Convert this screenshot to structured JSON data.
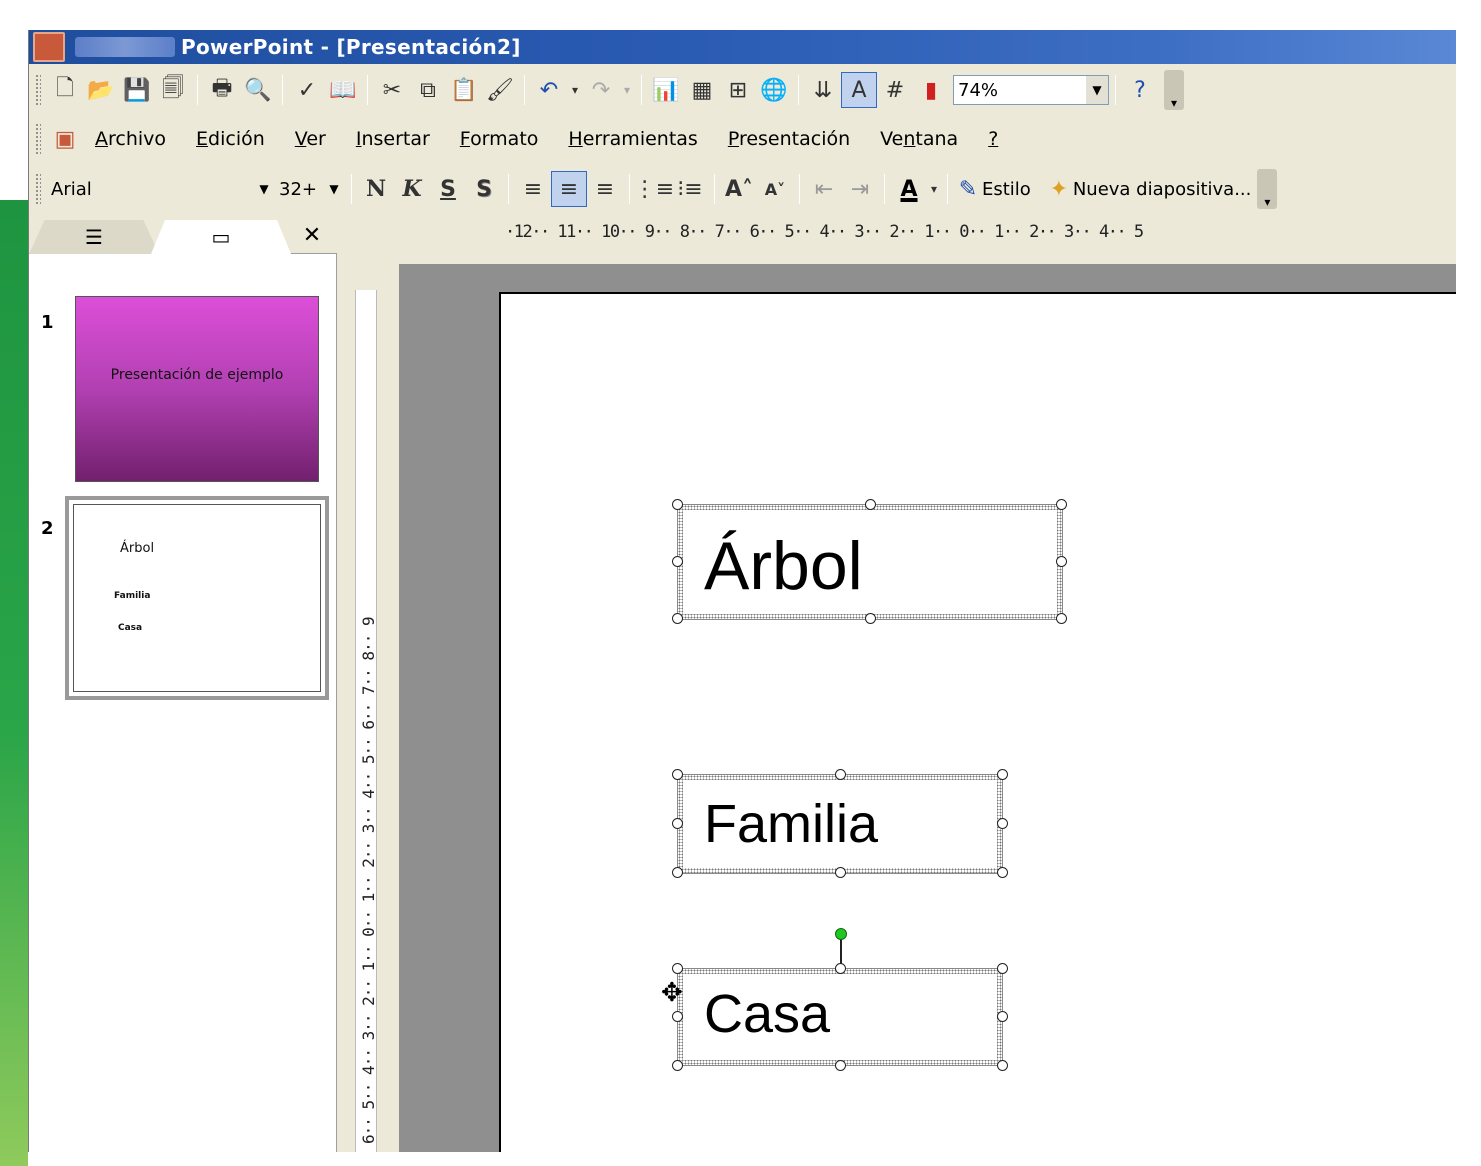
{
  "window": {
    "title": "PowerPoint - [Presentación2]"
  },
  "standard_toolbar": {
    "icons": [
      "new-icon",
      "open-icon",
      "save-icon",
      "permission-icon",
      "print-icon",
      "print-preview-icon",
      "spelling-icon",
      "research-icon",
      "cut-icon",
      "copy-icon",
      "paste-icon",
      "format-painter-icon",
      "undo-icon",
      "redo-icon",
      "insert-chart-icon",
      "insert-table-icon",
      "tables-borders-icon",
      "hyperlink-icon",
      "expand-icon",
      "show-formatting-icon",
      "grid-icon",
      "color-grayscale-icon",
      "help-icon"
    ],
    "zoom": "74%"
  },
  "menu": {
    "items": [
      {
        "label": "Archivo",
        "key": "A"
      },
      {
        "label": "Edición",
        "key": "E"
      },
      {
        "label": "Ver",
        "key": "V"
      },
      {
        "label": "Insertar",
        "key": "I"
      },
      {
        "label": "Formato",
        "key": "F"
      },
      {
        "label": "Herramientas",
        "key": "H"
      },
      {
        "label": "Presentación",
        "key": "P"
      },
      {
        "label": "Ventana",
        "key": "n"
      },
      {
        "label": "?",
        "key": "?"
      }
    ]
  },
  "format_toolbar": {
    "font": "Arial",
    "size": "32+",
    "bold": "N",
    "italic": "K",
    "underline": "S",
    "shadow": "S",
    "style_label": "Estilo",
    "new_slide_label": "Nueva diapositiva..."
  },
  "slides_pane": {
    "slides": [
      {
        "number": "1",
        "title": "Presentación de ejemplo"
      },
      {
        "number": "2",
        "items": [
          "Árbol",
          "Familia",
          "Casa"
        ]
      }
    ]
  },
  "rulers": {
    "horizontal": "·12·· 11·· 10·· 9·· 8·· 7·· 6·· 5·· 4·· 3·· 2·· 1·· 0·· 1·· 2·· 3·· 4·· 5",
    "vertical": "6·· 5·· 4·· 3·· 2·· 1·· 0·· 1·· 2·· 3·· 4·· 5·· 6·· 7·· 8·· 9"
  },
  "slide": {
    "textboxes": [
      {
        "text": "Árbol"
      },
      {
        "text": "Familia"
      },
      {
        "text": "Casa"
      }
    ]
  }
}
